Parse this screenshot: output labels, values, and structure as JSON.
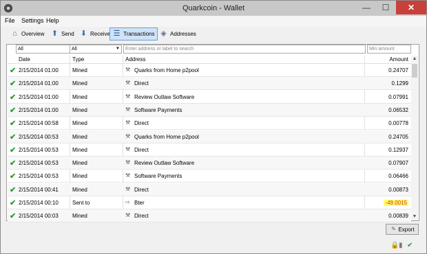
{
  "window": {
    "title": "Quarkcoin - Wallet",
    "minimize": "—",
    "maximize": "☐",
    "close": "✕"
  },
  "menu": {
    "items": [
      "File",
      "Settings",
      "Help"
    ]
  },
  "toolbar": {
    "buttons": [
      {
        "label": "Overview",
        "icon": "home-icon"
      },
      {
        "label": "Send",
        "icon": "send-arrow-icon"
      },
      {
        "label": "Receive",
        "icon": "receive-arrow-icon"
      },
      {
        "label": "Transactions",
        "icon": "transactions-list-icon",
        "active": true
      },
      {
        "label": "Addresses",
        "icon": "address-book-icon"
      }
    ]
  },
  "filters": {
    "date_filter": "All",
    "type_filter": "All",
    "address_placeholder": "Enter address or label to search",
    "amount_placeholder": "Min amount"
  },
  "table": {
    "headers": {
      "date": "Date",
      "type": "Type",
      "address": "Address",
      "amount": "Amount"
    },
    "rows": [
      {
        "date": "2/15/2014 01:00",
        "type": "Mined",
        "address": "Quarks from Home p2pool",
        "amount": "0.24707",
        "icon": "mining-icon"
      },
      {
        "date": "2/15/2014 01:00",
        "type": "Mined",
        "address": "Direct",
        "amount": "0.1299",
        "icon": "mining-icon"
      },
      {
        "date": "2/15/2014 01:00",
        "type": "Mined",
        "address": "Review Outlaw Software",
        "amount": "0.07991",
        "icon": "mining-icon"
      },
      {
        "date": "2/15/2014 01:00",
        "type": "Mined",
        "address": "Software Payments",
        "amount": "0.06532",
        "icon": "mining-icon"
      },
      {
        "date": "2/15/2014 00:58",
        "type": "Mined",
        "address": "Direct",
        "amount": "0.00778",
        "icon": "mining-icon"
      },
      {
        "date": "2/15/2014 00:53",
        "type": "Mined",
        "address": "Quarks from Home p2pool",
        "amount": "0.24705",
        "icon": "mining-icon"
      },
      {
        "date": "2/15/2014 00:53",
        "type": "Mined",
        "address": "Direct",
        "amount": "0.12937",
        "icon": "mining-icon"
      },
      {
        "date": "2/15/2014 00:53",
        "type": "Mined",
        "address": "Review Outlaw Software",
        "amount": "0.07907",
        "icon": "mining-icon"
      },
      {
        "date": "2/15/2014 00:53",
        "type": "Mined",
        "address": "Software Payments",
        "amount": "0.06466",
        "icon": "mining-icon"
      },
      {
        "date": "2/15/2014 00:41",
        "type": "Mined",
        "address": "Direct",
        "amount": "0.00873",
        "icon": "mining-icon"
      },
      {
        "date": "2/15/2014 00:10",
        "type": "Sent to",
        "address": "Bter",
        "amount": "-49.0015",
        "icon": "sent-icon",
        "highlight": true
      },
      {
        "date": "2/15/2014 00:03",
        "type": "Mined",
        "address": "Direct",
        "amount": "0.00839",
        "icon": "mining-icon"
      }
    ]
  },
  "export": {
    "label": "Export",
    "icon": "export-icon"
  },
  "status": {
    "icons": [
      "lock-icon",
      "network-icon",
      "sync-check-icon"
    ]
  },
  "colors": {
    "confirmed": "#2e9a2e",
    "negative": "#d03030",
    "highlight": "#ffff66",
    "active_tab": "#cfe3f8"
  }
}
